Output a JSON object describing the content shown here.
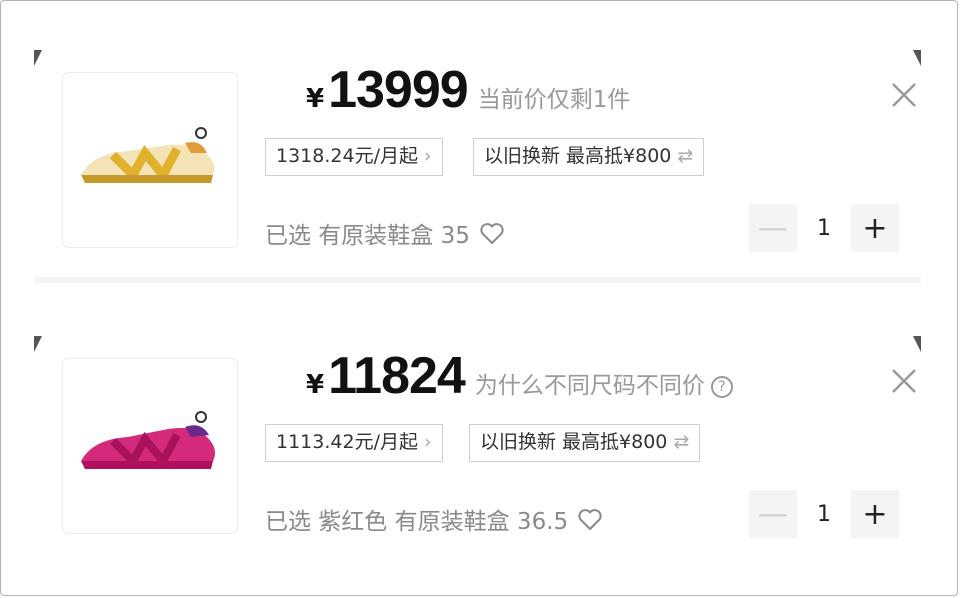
{
  "items": [
    {
      "currency": "¥",
      "price": "13999",
      "price_note": "当前价仅剩1件",
      "installment": "1318.24元/月起",
      "trade_in": "以旧换新 最高抵¥800",
      "selection": "已选 有原装鞋盒 35",
      "quantity": "1",
      "shoe_color": "#e3b72e",
      "shoe_base": "#f3dcaa"
    },
    {
      "currency": "¥",
      "price": "11824",
      "price_note": "为什么不同尺码不同价",
      "installment": "1113.42元/月起",
      "trade_in": "以旧换新 最高抵¥800",
      "selection": "已选 紫红色 有原装鞋盒 36.5",
      "quantity": "1",
      "shoe_color": "#c4186a",
      "shoe_base": "#d42a7c"
    }
  ],
  "icons": {
    "chevron": "›",
    "swap": "⇄",
    "minus": "—",
    "plus": "+",
    "question": "?"
  }
}
